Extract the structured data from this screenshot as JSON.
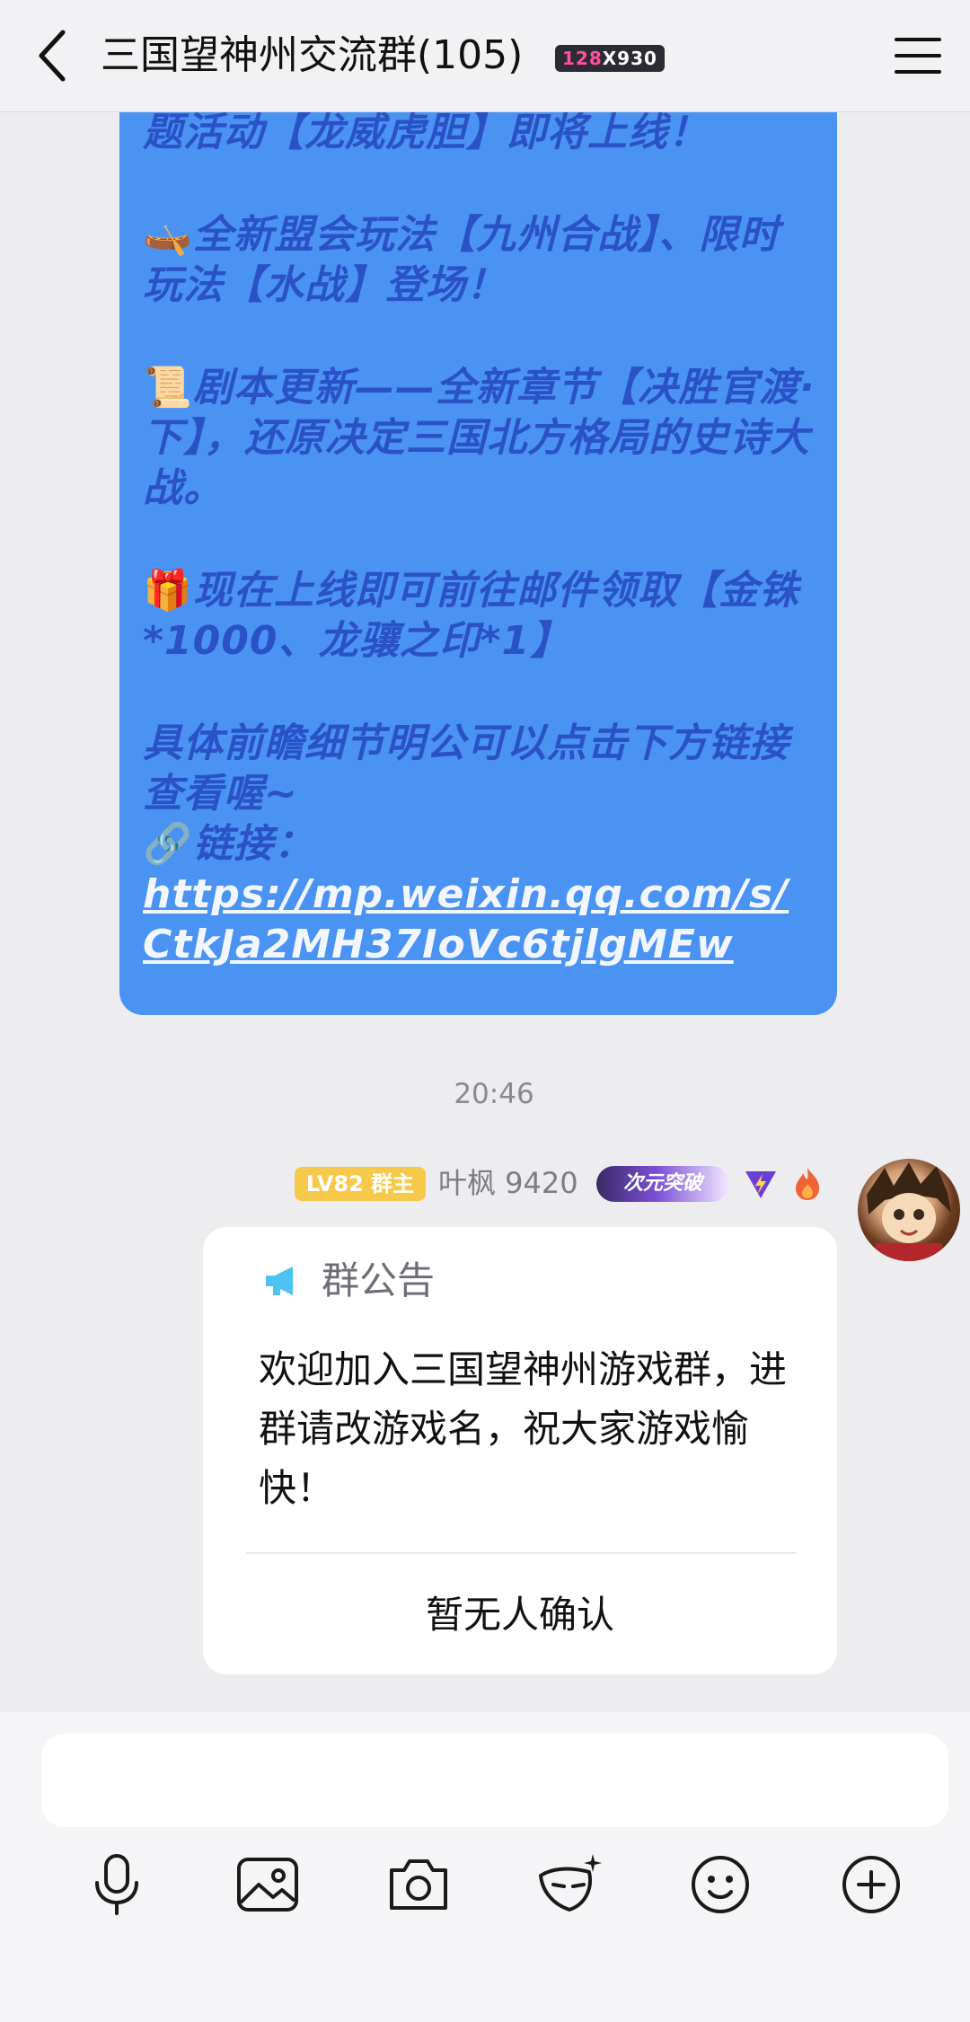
{
  "header": {
    "title": "三国望神州交流群(105)",
    "badge_prefix": "128",
    "badge_suffix": "X930"
  },
  "message": {
    "lines": [
      "题活动【龙威虎胆】即将上线！",
      "全新盟会玩法【九州合战】、限时玩法【水战】登场！",
      "剧本更新——全新章节【决胜官渡·下】，还原决定三国北方格局的史诗大战。",
      "现在上线即可前往邮件领取【金铢*1000、龙骧之印*1】",
      "具体前瞻细节明公可以点击下方链接查看喔~",
      "链接："
    ],
    "emojis": [
      "🛶",
      "📜",
      "🎁",
      "🔗"
    ],
    "link": "https://mp.weixin.qq.com/s/CtkJa2MH37IoVc6tjlgMEw"
  },
  "timestamp": "20:46",
  "sender": {
    "level_badge": "LV82 群主",
    "name": "叶枫 9420",
    "title_badge": "次元突破"
  },
  "notice": {
    "title": "群公告",
    "body": "欢迎加入三国望神州游戏群，进群请改游戏名，祝大家游戏愉快！",
    "confirm": "暂无人确认"
  },
  "input": {
    "placeholder": ""
  },
  "toolbar": {
    "icons": [
      "microphone-icon",
      "image-icon",
      "camera-icon",
      "mask-icon",
      "emoji-icon",
      "plus-icon"
    ]
  },
  "colors": {
    "bubble": "#4b93f3",
    "bubble_text": "#2a52c6",
    "level_badge": "#f7c94a"
  }
}
